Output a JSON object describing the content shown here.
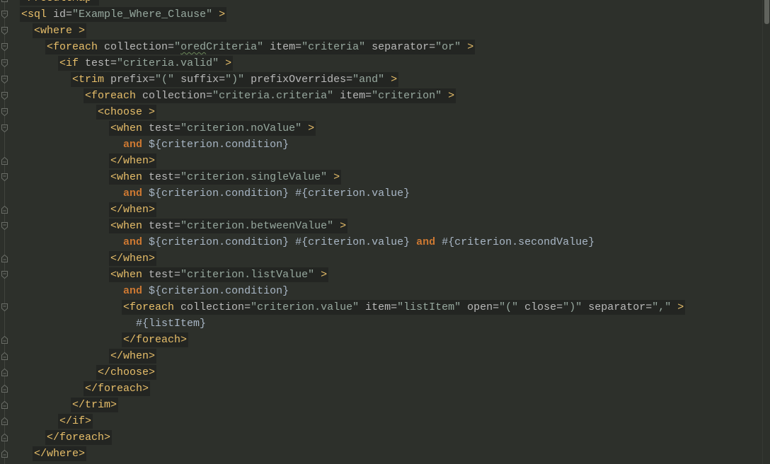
{
  "colors": {
    "background": "#2d302b",
    "tag_highlight": "#232522",
    "tag": "#e8bf6a",
    "attribute": "#bababa",
    "value": "#97a99f",
    "keyword": "#cc7832",
    "text": "#a9b7c6",
    "typo_underline": "#6a8759"
  },
  "editor": {
    "lines": [
      {
        "indent": "  ",
        "fold": "fold-close-icon",
        "tokens": [
          {
            "t": "tag",
            "v": "</resultMap>"
          }
        ]
      },
      {
        "indent": "  ",
        "fold": "fold-open-icon",
        "tokens": [
          {
            "t": "tag",
            "v": "<sql"
          },
          {
            "t": "attr",
            "v": " id="
          },
          {
            "t": "val",
            "v": "\"Example_Where_Clause\""
          },
          {
            "t": "tag",
            "v": " >"
          }
        ]
      },
      {
        "indent": "    ",
        "fold": "fold-open-icon",
        "tokens": [
          {
            "t": "tag",
            "v": "<where >"
          }
        ]
      },
      {
        "indent": "      ",
        "fold": "fold-open-icon",
        "tokens": [
          {
            "t": "tag",
            "v": "<foreach"
          },
          {
            "t": "attr",
            "v": " collection="
          },
          {
            "t": "val",
            "v": "\""
          },
          {
            "t": "val",
            "v": "ored",
            "typo": true
          },
          {
            "t": "val",
            "v": "Criteria\""
          },
          {
            "t": "attr",
            "v": " item="
          },
          {
            "t": "val",
            "v": "\"criteria\""
          },
          {
            "t": "attr",
            "v": " separator="
          },
          {
            "t": "val",
            "v": "\"or\""
          },
          {
            "t": "tag",
            "v": " >"
          }
        ]
      },
      {
        "indent": "        ",
        "fold": "fold-open-icon",
        "tokens": [
          {
            "t": "tag",
            "v": "<if"
          },
          {
            "t": "attr",
            "v": " test="
          },
          {
            "t": "val",
            "v": "\"criteria.valid\""
          },
          {
            "t": "tag",
            "v": " >"
          }
        ]
      },
      {
        "indent": "          ",
        "fold": "fold-open-icon",
        "tokens": [
          {
            "t": "tag",
            "v": "<trim"
          },
          {
            "t": "attr",
            "v": " prefix="
          },
          {
            "t": "val",
            "v": "\"(\""
          },
          {
            "t": "attr",
            "v": " suffix="
          },
          {
            "t": "val",
            "v": "\")\""
          },
          {
            "t": "attr",
            "v": " prefixOverrides="
          },
          {
            "t": "val",
            "v": "\"and\""
          },
          {
            "t": "tag",
            "v": " >"
          }
        ]
      },
      {
        "indent": "            ",
        "fold": "fold-open-icon",
        "tokens": [
          {
            "t": "tag",
            "v": "<foreach"
          },
          {
            "t": "attr",
            "v": " collection="
          },
          {
            "t": "val",
            "v": "\"criteria.criteria\""
          },
          {
            "t": "attr",
            "v": " item="
          },
          {
            "t": "val",
            "v": "\"criterion\""
          },
          {
            "t": "tag",
            "v": " >"
          }
        ]
      },
      {
        "indent": "              ",
        "fold": "fold-open-icon",
        "tokens": [
          {
            "t": "tag",
            "v": "<choose >"
          }
        ]
      },
      {
        "indent": "                ",
        "fold": "fold-open-icon",
        "tokens": [
          {
            "t": "tag",
            "v": "<when"
          },
          {
            "t": "attr",
            "v": " test="
          },
          {
            "t": "val",
            "v": "\"criterion.noValue\""
          },
          {
            "t": "tag",
            "v": " >"
          }
        ]
      },
      {
        "indent": "                  ",
        "tokens": [
          {
            "t": "kw",
            "v": "and"
          },
          {
            "t": "text",
            "v": " ${criterion.condition}"
          }
        ]
      },
      {
        "indent": "                ",
        "fold": "fold-close-icon",
        "tokens": [
          {
            "t": "tag",
            "v": "</when>"
          }
        ]
      },
      {
        "indent": "                ",
        "fold": "fold-open-icon",
        "tokens": [
          {
            "t": "tag",
            "v": "<when"
          },
          {
            "t": "attr",
            "v": " test="
          },
          {
            "t": "val",
            "v": "\"criterion.singleValue\""
          },
          {
            "t": "tag",
            "v": " >"
          }
        ]
      },
      {
        "indent": "                  ",
        "tokens": [
          {
            "t": "kw",
            "v": "and"
          },
          {
            "t": "text",
            "v": " ${criterion.condition} #{criterion.value}"
          }
        ]
      },
      {
        "indent": "                ",
        "fold": "fold-close-icon",
        "tokens": [
          {
            "t": "tag",
            "v": "</when>"
          }
        ]
      },
      {
        "indent": "                ",
        "fold": "fold-open-icon",
        "tokens": [
          {
            "t": "tag",
            "v": "<when"
          },
          {
            "t": "attr",
            "v": " test="
          },
          {
            "t": "val",
            "v": "\"criterion.betweenValue\""
          },
          {
            "t": "tag",
            "v": " >"
          }
        ]
      },
      {
        "indent": "                  ",
        "tokens": [
          {
            "t": "kw",
            "v": "and"
          },
          {
            "t": "text",
            "v": " ${criterion.condition} #{criterion.value} "
          },
          {
            "t": "kw",
            "v": "and"
          },
          {
            "t": "text",
            "v": " #{criterion.secondValue}"
          }
        ]
      },
      {
        "indent": "                ",
        "fold": "fold-close-icon",
        "tokens": [
          {
            "t": "tag",
            "v": "</when>"
          }
        ]
      },
      {
        "indent": "                ",
        "fold": "fold-open-icon",
        "tokens": [
          {
            "t": "tag",
            "v": "<when"
          },
          {
            "t": "attr",
            "v": " test="
          },
          {
            "t": "val",
            "v": "\"criterion.listValue\""
          },
          {
            "t": "tag",
            "v": " >"
          }
        ]
      },
      {
        "indent": "                  ",
        "tokens": [
          {
            "t": "kw",
            "v": "and"
          },
          {
            "t": "text",
            "v": " ${criterion.condition}"
          }
        ]
      },
      {
        "indent": "                  ",
        "fold": "fold-open-icon",
        "tokens": [
          {
            "t": "tag",
            "v": "<foreach"
          },
          {
            "t": "attr",
            "v": " collection="
          },
          {
            "t": "val",
            "v": "\"criterion.value\""
          },
          {
            "t": "attr",
            "v": " item="
          },
          {
            "t": "val",
            "v": "\"listItem\""
          },
          {
            "t": "attr",
            "v": " open="
          },
          {
            "t": "val",
            "v": "\"(\""
          },
          {
            "t": "attr",
            "v": " close="
          },
          {
            "t": "val",
            "v": "\")\""
          },
          {
            "t": "attr",
            "v": " separator="
          },
          {
            "t": "val",
            "v": "\",\""
          },
          {
            "t": "tag",
            "v": " >"
          }
        ]
      },
      {
        "indent": "                    ",
        "tokens": [
          {
            "t": "text",
            "v": "#{listItem}"
          }
        ]
      },
      {
        "indent": "                  ",
        "fold": "fold-close-icon",
        "tokens": [
          {
            "t": "tag",
            "v": "</foreach>"
          }
        ]
      },
      {
        "indent": "                ",
        "fold": "fold-close-icon",
        "tokens": [
          {
            "t": "tag",
            "v": "</when>"
          }
        ]
      },
      {
        "indent": "              ",
        "fold": "fold-close-icon",
        "tokens": [
          {
            "t": "tag",
            "v": "</choose>"
          }
        ]
      },
      {
        "indent": "            ",
        "fold": "fold-close-icon",
        "tokens": [
          {
            "t": "tag",
            "v": "</foreach>"
          }
        ]
      },
      {
        "indent": "          ",
        "fold": "fold-close-icon",
        "tokens": [
          {
            "t": "tag",
            "v": "</trim>"
          }
        ]
      },
      {
        "indent": "        ",
        "fold": "fold-close-icon",
        "tokens": [
          {
            "t": "tag",
            "v": "</if>"
          }
        ]
      },
      {
        "indent": "      ",
        "fold": "fold-close-icon",
        "tokens": [
          {
            "t": "tag",
            "v": "</foreach>"
          }
        ]
      },
      {
        "indent": "    ",
        "fold": "fold-close-icon",
        "tokens": [
          {
            "t": "tag",
            "v": "</where>"
          }
        ]
      }
    ]
  }
}
